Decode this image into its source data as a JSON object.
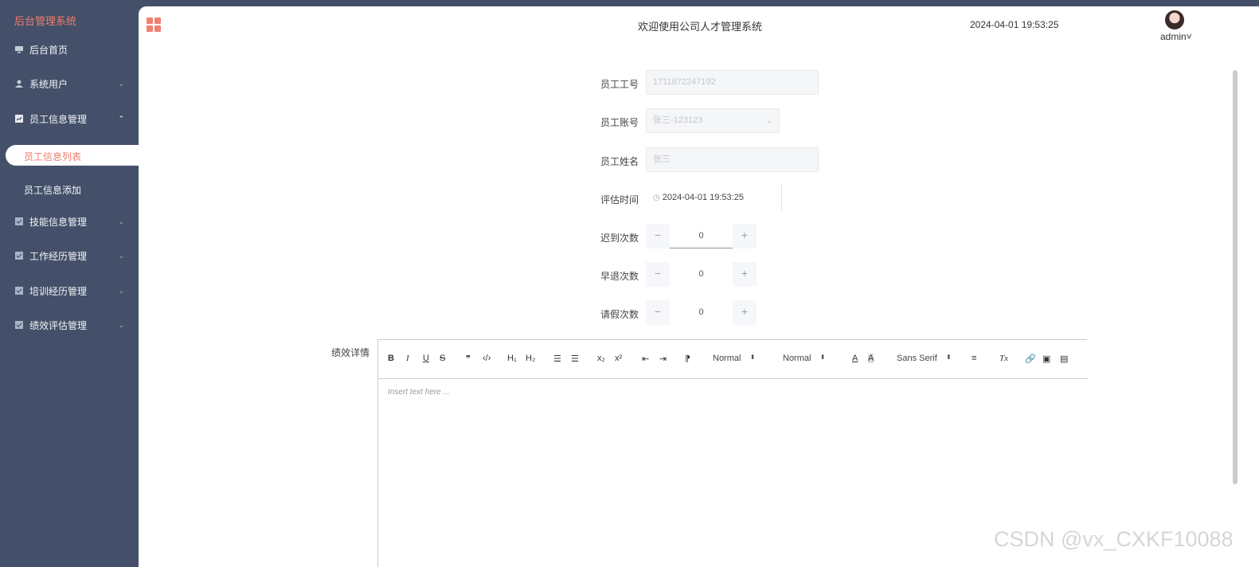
{
  "brand": "后台管理系统",
  "sidebar": {
    "items": [
      {
        "label": "后台首页",
        "icon": "monitor-icon",
        "arrow": ""
      },
      {
        "label": "系统用户",
        "icon": "user-icon",
        "arrow": "⌄"
      },
      {
        "label": "员工信息管理",
        "icon": "chart-icon",
        "arrow": "⌃"
      },
      {
        "label": "技能信息管理",
        "icon": "check-icon",
        "arrow": "⌄"
      },
      {
        "label": "工作经历管理",
        "icon": "check-icon",
        "arrow": "⌄"
      },
      {
        "label": "培训经历管理",
        "icon": "check-icon",
        "arrow": "⌄"
      },
      {
        "label": "绩效评估管理",
        "icon": "check-icon",
        "arrow": "⌄"
      }
    ],
    "sub_items": [
      "员工信息列表",
      "员工信息添加"
    ]
  },
  "header": {
    "welcome": "欢迎使用公司人才管理系统",
    "datetime": "2024-04-01 19:53:25",
    "username": "admin",
    "user_caret": "˅"
  },
  "form": {
    "employee_no_label": "员工工号",
    "employee_no_value": "1711872247192",
    "employee_account_label": "员工账号",
    "employee_account_value": "张三-123123",
    "employee_name_label": "员工姓名",
    "employee_name_value": "张三",
    "eval_time_label": "评估时间",
    "eval_time_value": "2024-04-01 19:53:25",
    "late_label": "迟到次数",
    "late_value": "0",
    "early_label": "早退次数",
    "early_value": "0",
    "leave_label": "请假次数",
    "leave_value": "0",
    "minus": "−",
    "plus": "+",
    "detail_label": "绩效详情"
  },
  "editor": {
    "placeholder": "Insert text here ...",
    "header_select": "Normal",
    "size_select": "Normal",
    "font_select": "Sans Serif",
    "tools": {
      "bold": "B",
      "italic": "I",
      "underline": "U",
      "strike": "S",
      "quote": "❞",
      "code": "‹/›",
      "h1": "H₁",
      "h2": "H₂",
      "ol": "☰",
      "ul": "☰",
      "sub": "x₂",
      "sup": "x²",
      "outdent": "⇤",
      "indent": "⇥",
      "rtl": "⁋",
      "color": "A",
      "bg": "A",
      "align": "≡",
      "clean": "Tx",
      "link": "🔗",
      "image": "▣",
      "video": "▤"
    }
  },
  "watermark": "CSDN @vx_CXKF10088",
  "colors": {
    "sidebar": "#445069",
    "accent": "#f07c6a"
  }
}
